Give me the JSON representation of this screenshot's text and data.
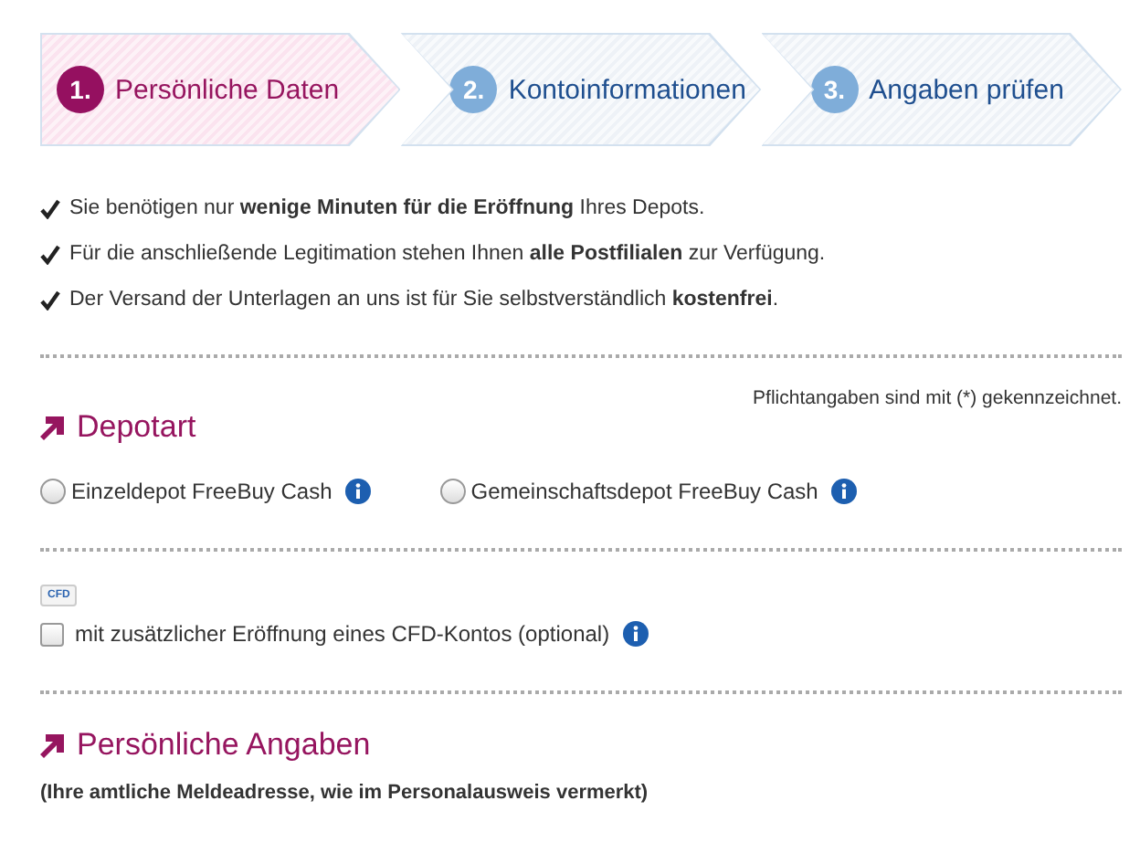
{
  "steps": [
    {
      "number": "1.",
      "label": "Persönliche Daten",
      "selected": true
    },
    {
      "number": "2.",
      "label": "Kontoinformationen",
      "selected": false
    },
    {
      "number": "3.",
      "label": "Angaben prüfen",
      "selected": false
    }
  ],
  "benefits": [
    "Sie benötigen nur **wenige Minuten für die Eröffnung** Ihres Depots.",
    "Für die anschließende Legitimation stehen Ihnen **alle Postfilialen** zur Verfügung.",
    "Der Versand der Unterlagen an uns ist für Sie selbstverständlich **kostenfrei**."
  ],
  "required_note": "Pflichtangaben sind mit (*) gekennzeichnet.",
  "depotart": {
    "heading": "Depotart",
    "options": [
      {
        "label": "Einzeldepot FreeBuy Cash",
        "selected": false
      },
      {
        "label": "Gemeinschaftsdepot FreeBuy Cash",
        "selected": false
      }
    ]
  },
  "cfd": {
    "badge": "CFD",
    "option": {
      "label": "mit zusätzlicher Eröffnung eines CFD-Kontos (optional)",
      "checked": false
    }
  },
  "personal": {
    "heading": "Persönliche Angaben",
    "subtitle": "(Ihre amtliche Meldeadresse, wie im Personalausweis vermerkt)"
  }
}
